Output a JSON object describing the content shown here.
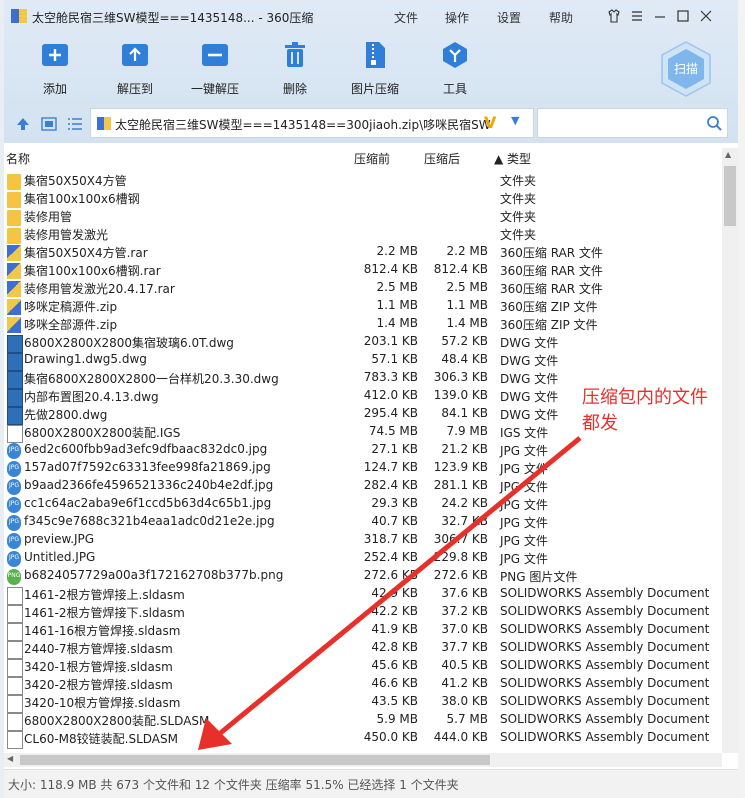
{
  "window": {
    "title": "太空舱民宿三维SW模型===1435148... - 360压缩",
    "menu": [
      "文件",
      "操作",
      "设置",
      "帮助"
    ]
  },
  "toolbar": {
    "buttons": [
      {
        "label": "添加",
        "icon": "add-icon"
      },
      {
        "label": "解压到",
        "icon": "extract-to-icon"
      },
      {
        "label": "一键解压",
        "icon": "one-click-extract-icon"
      },
      {
        "label": "删除",
        "icon": "trash-icon"
      },
      {
        "label": "图片压缩",
        "icon": "image-compress-icon"
      },
      {
        "label": "工具",
        "icon": "tools-icon"
      }
    ],
    "scan_label": "扫描"
  },
  "address": {
    "path": "太空舱民宿三维SW模型===1435148==300jiaoh.zip\\哆咪民宿SW",
    "search_placeholder": ""
  },
  "columns": {
    "name": "名称",
    "compressed": "压缩前",
    "original": "压缩后",
    "type": "▲ 类型"
  },
  "files": [
    {
      "name": "集宿50X50X4方管",
      "cs": "",
      "os": "",
      "type": "文件夹",
      "icon": "folder"
    },
    {
      "name": "集宿100x100x6槽钢",
      "cs": "",
      "os": "",
      "type": "文件夹",
      "icon": "folder"
    },
    {
      "name": "装修用管",
      "cs": "",
      "os": "",
      "type": "文件夹",
      "icon": "folder"
    },
    {
      "name": "装修用管发激光",
      "cs": "",
      "os": "",
      "type": "文件夹",
      "icon": "folder"
    },
    {
      "name": "集宿50X50X4方管.rar",
      "cs": "2.2 MB",
      "os": "2.2 MB",
      "type": "360压缩 RAR 文件",
      "icon": "rar"
    },
    {
      "name": "集宿100x100x6槽钢.rar",
      "cs": "812.4 KB",
      "os": "812.4 KB",
      "type": "360压缩 RAR 文件",
      "icon": "rar"
    },
    {
      "name": "装修用管发激光20.4.17.rar",
      "cs": "2.5 MB",
      "os": "2.5 MB",
      "type": "360压缩 RAR 文件",
      "icon": "rar"
    },
    {
      "name": "哆咪定稿源件.zip",
      "cs": "1.1 MB",
      "os": "1.1 MB",
      "type": "360压缩 ZIP 文件",
      "icon": "zip"
    },
    {
      "name": "哆咪全部源件.zip",
      "cs": "1.4 MB",
      "os": "1.4 MB",
      "type": "360压缩 ZIP 文件",
      "icon": "zip"
    },
    {
      "name": "6800X2800X2800集宿玻璃6.0T.dwg",
      "cs": "203.1 KB",
      "os": "57.2 KB",
      "type": "DWG 文件",
      "icon": "dwg"
    },
    {
      "name": "Drawing1.dwg5.dwg",
      "cs": "57.1 KB",
      "os": "48.4 KB",
      "type": "DWG 文件",
      "icon": "dwg"
    },
    {
      "name": "集宿6800X2800X2800一台样机20.3.30.dwg",
      "cs": "783.3 KB",
      "os": "306.3 KB",
      "type": "DWG 文件",
      "icon": "dwg"
    },
    {
      "name": "内部布置图20.4.13.dwg",
      "cs": "412.0 KB",
      "os": "139.0 KB",
      "type": "DWG 文件",
      "icon": "dwg"
    },
    {
      "name": "先做2800.dwg",
      "cs": "295.4 KB",
      "os": "84.1 KB",
      "type": "DWG 文件",
      "icon": "dwg"
    },
    {
      "name": "6800X2800X2800装配.IGS",
      "cs": "74.5 MB",
      "os": "7.9 MB",
      "type": "IGS 文件",
      "icon": "doc"
    },
    {
      "name": "6ed2c600fbb9ad3efc9dfbaac832dc0.jpg",
      "cs": "27.1 KB",
      "os": "21.2 KB",
      "type": "JPG 文件",
      "icon": "jpg"
    },
    {
      "name": "157ad07f7592c63313fee998fa21869.jpg",
      "cs": "124.7 KB",
      "os": "123.9 KB",
      "type": "JPG 文件",
      "icon": "jpg"
    },
    {
      "name": "b9aad2366fe4596521336c240b4e2df.jpg",
      "cs": "282.4 KB",
      "os": "281.1 KB",
      "type": "JPG 文件",
      "icon": "jpg"
    },
    {
      "name": "cc1c64ac2aba9e6f1ccd5b63d4c65b1.jpg",
      "cs": "29.3 KB",
      "os": "24.2 KB",
      "type": "JPG 文件",
      "icon": "jpg"
    },
    {
      "name": "f345c9e7688c321b4eaa1adc0d21e2e.jpg",
      "cs": "40.7 KB",
      "os": "32.7 KB",
      "type": "JPG 文件",
      "icon": "jpg"
    },
    {
      "name": "preview.JPG",
      "cs": "318.7 KB",
      "os": "306.7 KB",
      "type": "JPG 文件",
      "icon": "jpg"
    },
    {
      "name": "Untitled.JPG",
      "cs": "252.4 KB",
      "os": "229.8 KB",
      "type": "JPG 文件",
      "icon": "jpg"
    },
    {
      "name": "b6824057729a00a3f172162708b377b.png",
      "cs": "272.6 KB",
      "os": "272.6 KB",
      "type": "PNG 图片文件",
      "icon": "png"
    },
    {
      "name": "1461-2根方管焊接上.sldasm",
      "cs": "42.9 KB",
      "os": "37.6 KB",
      "type": "SOLIDWORKS Assembly Document",
      "icon": "doc"
    },
    {
      "name": "1461-2根方管焊接下.sldasm",
      "cs": "42.2 KB",
      "os": "37.2 KB",
      "type": "SOLIDWORKS Assembly Document",
      "icon": "doc"
    },
    {
      "name": "1461-16根方管焊接.sldasm",
      "cs": "41.9 KB",
      "os": "37.0 KB",
      "type": "SOLIDWORKS Assembly Document",
      "icon": "doc"
    },
    {
      "name": "2440-7根方管焊接.sldasm",
      "cs": "42.8 KB",
      "os": "37.7 KB",
      "type": "SOLIDWORKS Assembly Document",
      "icon": "doc"
    },
    {
      "name": "3420-1根方管焊接.sldasm",
      "cs": "45.6 KB",
      "os": "40.5 KB",
      "type": "SOLIDWORKS Assembly Document",
      "icon": "doc"
    },
    {
      "name": "3420-2根方管焊接.sldasm",
      "cs": "46.6 KB",
      "os": "41.2 KB",
      "type": "SOLIDWORKS Assembly Document",
      "icon": "doc"
    },
    {
      "name": "3420-10根方管焊接.sldasm",
      "cs": "43.5 KB",
      "os": "38.0 KB",
      "type": "SOLIDWORKS Assembly Document",
      "icon": "doc"
    },
    {
      "name": "6800X2800X2800装配.SLDASM",
      "cs": "5.9 MB",
      "os": "5.7 MB",
      "type": "SOLIDWORKS Assembly Document",
      "icon": "doc"
    },
    {
      "name": "CL60-M8铰链装配.SLDASM",
      "cs": "450.0 KB",
      "os": "444.0 KB",
      "type": "SOLIDWORKS Assembly Document",
      "icon": "doc"
    }
  ],
  "status": "大小: 118.9 MB 共 673 个文件和 12 个文件夹 压缩率 51.5% 已经选择 1 个文件夹",
  "annotation": {
    "line1": "压缩包内的文件",
    "line2": "都发",
    "color": "#e8302b"
  },
  "colors": {
    "accent": "#2f7fd8",
    "chrome": "#d9e6f3"
  }
}
